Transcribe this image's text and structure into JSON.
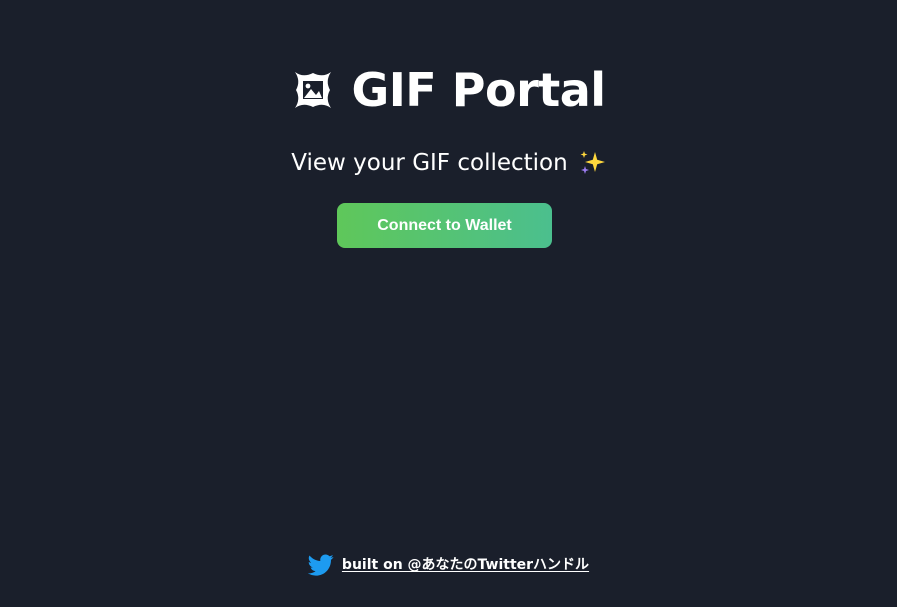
{
  "header": {
    "title": "GIF Portal",
    "title_icon": "picture-frame-icon",
    "subtitle": "View your GIF collection",
    "subtitle_icon": "sparkles-icon"
  },
  "main": {
    "connect_button_label": "Connect to Wallet"
  },
  "footer": {
    "icon": "twitter-bird-icon",
    "link_text": "built on @あなたのTwitterハンドル"
  },
  "colors": {
    "background": "#1a1f2b",
    "button_gradient_start": "#5fc75a",
    "button_gradient_end": "#4bbf8e",
    "twitter_blue": "#1d9bf0",
    "text": "#ffffff"
  }
}
